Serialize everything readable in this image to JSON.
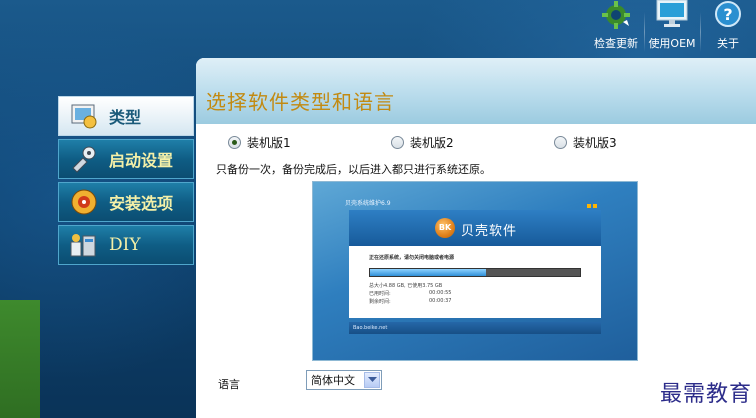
{
  "toolbar": {
    "items": [
      {
        "label": "检查更新",
        "icon": "gear-update-icon"
      },
      {
        "label": "使用OEM",
        "icon": "monitor-icon"
      },
      {
        "label": "关于",
        "icon": "help-icon"
      }
    ]
  },
  "nav": {
    "items": [
      {
        "label": "类型",
        "icon": "type-icon",
        "active": true
      },
      {
        "label": "启动设置",
        "icon": "boot-icon",
        "active": false
      },
      {
        "label": "安装选项",
        "icon": "install-icon",
        "active": false
      },
      {
        "label": "DIY",
        "icon": "diy-icon",
        "active": false
      }
    ]
  },
  "main": {
    "title": "选择软件类型和语言",
    "options": [
      {
        "label": "装机版1",
        "selected": true
      },
      {
        "label": "装机版2",
        "selected": false
      },
      {
        "label": "装机版3",
        "selected": false
      }
    ],
    "description": "只备份一次，备份完成后，以后进入都只进行系统还原。",
    "language_label": "语言",
    "language_value": "简体中文"
  },
  "preview": {
    "window_title": "贝壳系统维护6.9",
    "logo": "BK",
    "brand": "贝壳软件",
    "message": "正在还原系统，请勿关闭电脑或者电源",
    "progress": 0.55,
    "stats": [
      {
        "label": "总大小4.88 GB, 已使用3.75 GB",
        "value": ""
      },
      {
        "label": "已用时间:",
        "value": "00:00:55"
      },
      {
        "label": "剩余时间:",
        "value": "00:00:37"
      }
    ],
    "footer": "Bao.beike.net"
  },
  "watermark": "最需教育",
  "colors": {
    "title": "#c28a12",
    "nav_text": "#f4f0a8",
    "nav_bg": "#0f5d85",
    "background": "#0f4472"
  }
}
